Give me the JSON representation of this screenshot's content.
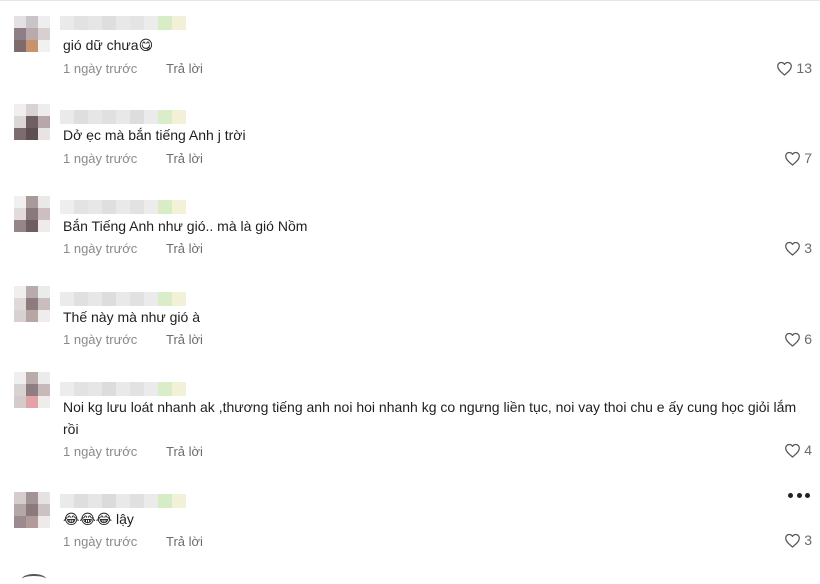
{
  "comments": [
    {
      "text": "gió dữ chưa😋",
      "time": "1 ngày trước",
      "reply": "Trả lời",
      "likes": "13"
    },
    {
      "text": "Dở ẹc mà bắn tiếng Anh j trời",
      "time": "1 ngày trước",
      "reply": "Trả lời",
      "likes": "7"
    },
    {
      "text": "Bắn Tiếng Anh như gió.. mà là gió Nồm",
      "time": "1 ngày trước",
      "reply": "Trả lời",
      "likes": "3"
    },
    {
      "text": "Thế này mà như gió à",
      "time": "1 ngày trước",
      "reply": "Trả lời",
      "likes": "6"
    },
    {
      "text": "Noi kg lưu loát nhanh ak ,thương tiếng anh noi hoi nhanh kg co ngưng liền tục, noi vay thoi chu e ấy cung học giỏi lắm rồi",
      "time": "1 ngày trước",
      "reply": "Trả lời",
      "likes": "4"
    },
    {
      "text": "😂😂😂 lậy",
      "time": "1 ngày trước",
      "reply": "Trả lời",
      "likes": "3"
    }
  ],
  "icons": {
    "like": "heart-outline-icon",
    "more": "more-horizontal-icon"
  },
  "colors": {
    "text": "#1f1f1f",
    "meta": "#8a8a8a"
  }
}
